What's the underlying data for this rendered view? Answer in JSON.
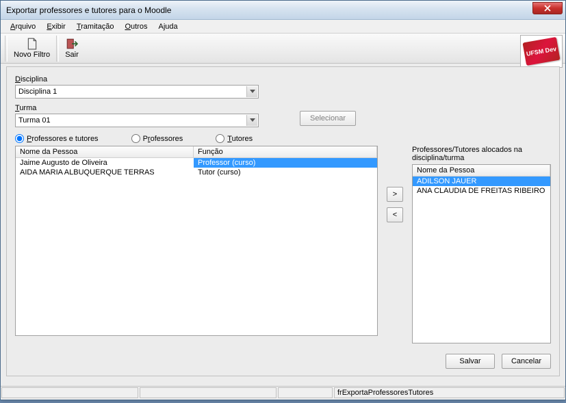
{
  "window": {
    "title": "Exportar professores e tutores para o Moodle"
  },
  "menu": {
    "arquivo": "Arquivo",
    "exibir": "Exibir",
    "tramitacao": "Tramitação",
    "outros": "Outros",
    "ajuda": "Ajuda"
  },
  "toolbar": {
    "novo_filtro": "Novo Filtro",
    "sair": "Sair"
  },
  "logo_text": "UFSM Dev",
  "fields": {
    "disciplina_label": "Disciplina",
    "disciplina_value": "Disciplina 1",
    "turma_label": "Turma",
    "turma_value": "Turma 01",
    "selecionar": "Selecionar"
  },
  "radios": {
    "prof_tutores": "Professores e tutores",
    "professores": "Professores",
    "tutores": "Tutores"
  },
  "left_list": {
    "col_nome": "Nome da Pessoa",
    "col_funcao": "Função",
    "rows": [
      {
        "nome": "Jaime Augusto de Oliveira",
        "funcao": "Professor (curso)",
        "selected": true
      },
      {
        "nome": "AIDA MARIA ALBUQUERQUE TERRAS",
        "funcao": "Tutor (curso)",
        "selected": false
      }
    ]
  },
  "right_list": {
    "title": "Professores/Tutores alocados na disciplina/turma",
    "col_nome": "Nome da Pessoa",
    "rows": [
      {
        "nome": "ADILSON JAUER",
        "selected": true
      },
      {
        "nome": "ANA CLAUDIA DE FREITAS RIBEIRO",
        "selected": false
      }
    ]
  },
  "move": {
    "right": ">",
    "left": "<"
  },
  "buttons": {
    "salvar": "Salvar",
    "cancelar": "Cancelar"
  },
  "status": {
    "form_name": "frExportaProfessoresTutores"
  }
}
